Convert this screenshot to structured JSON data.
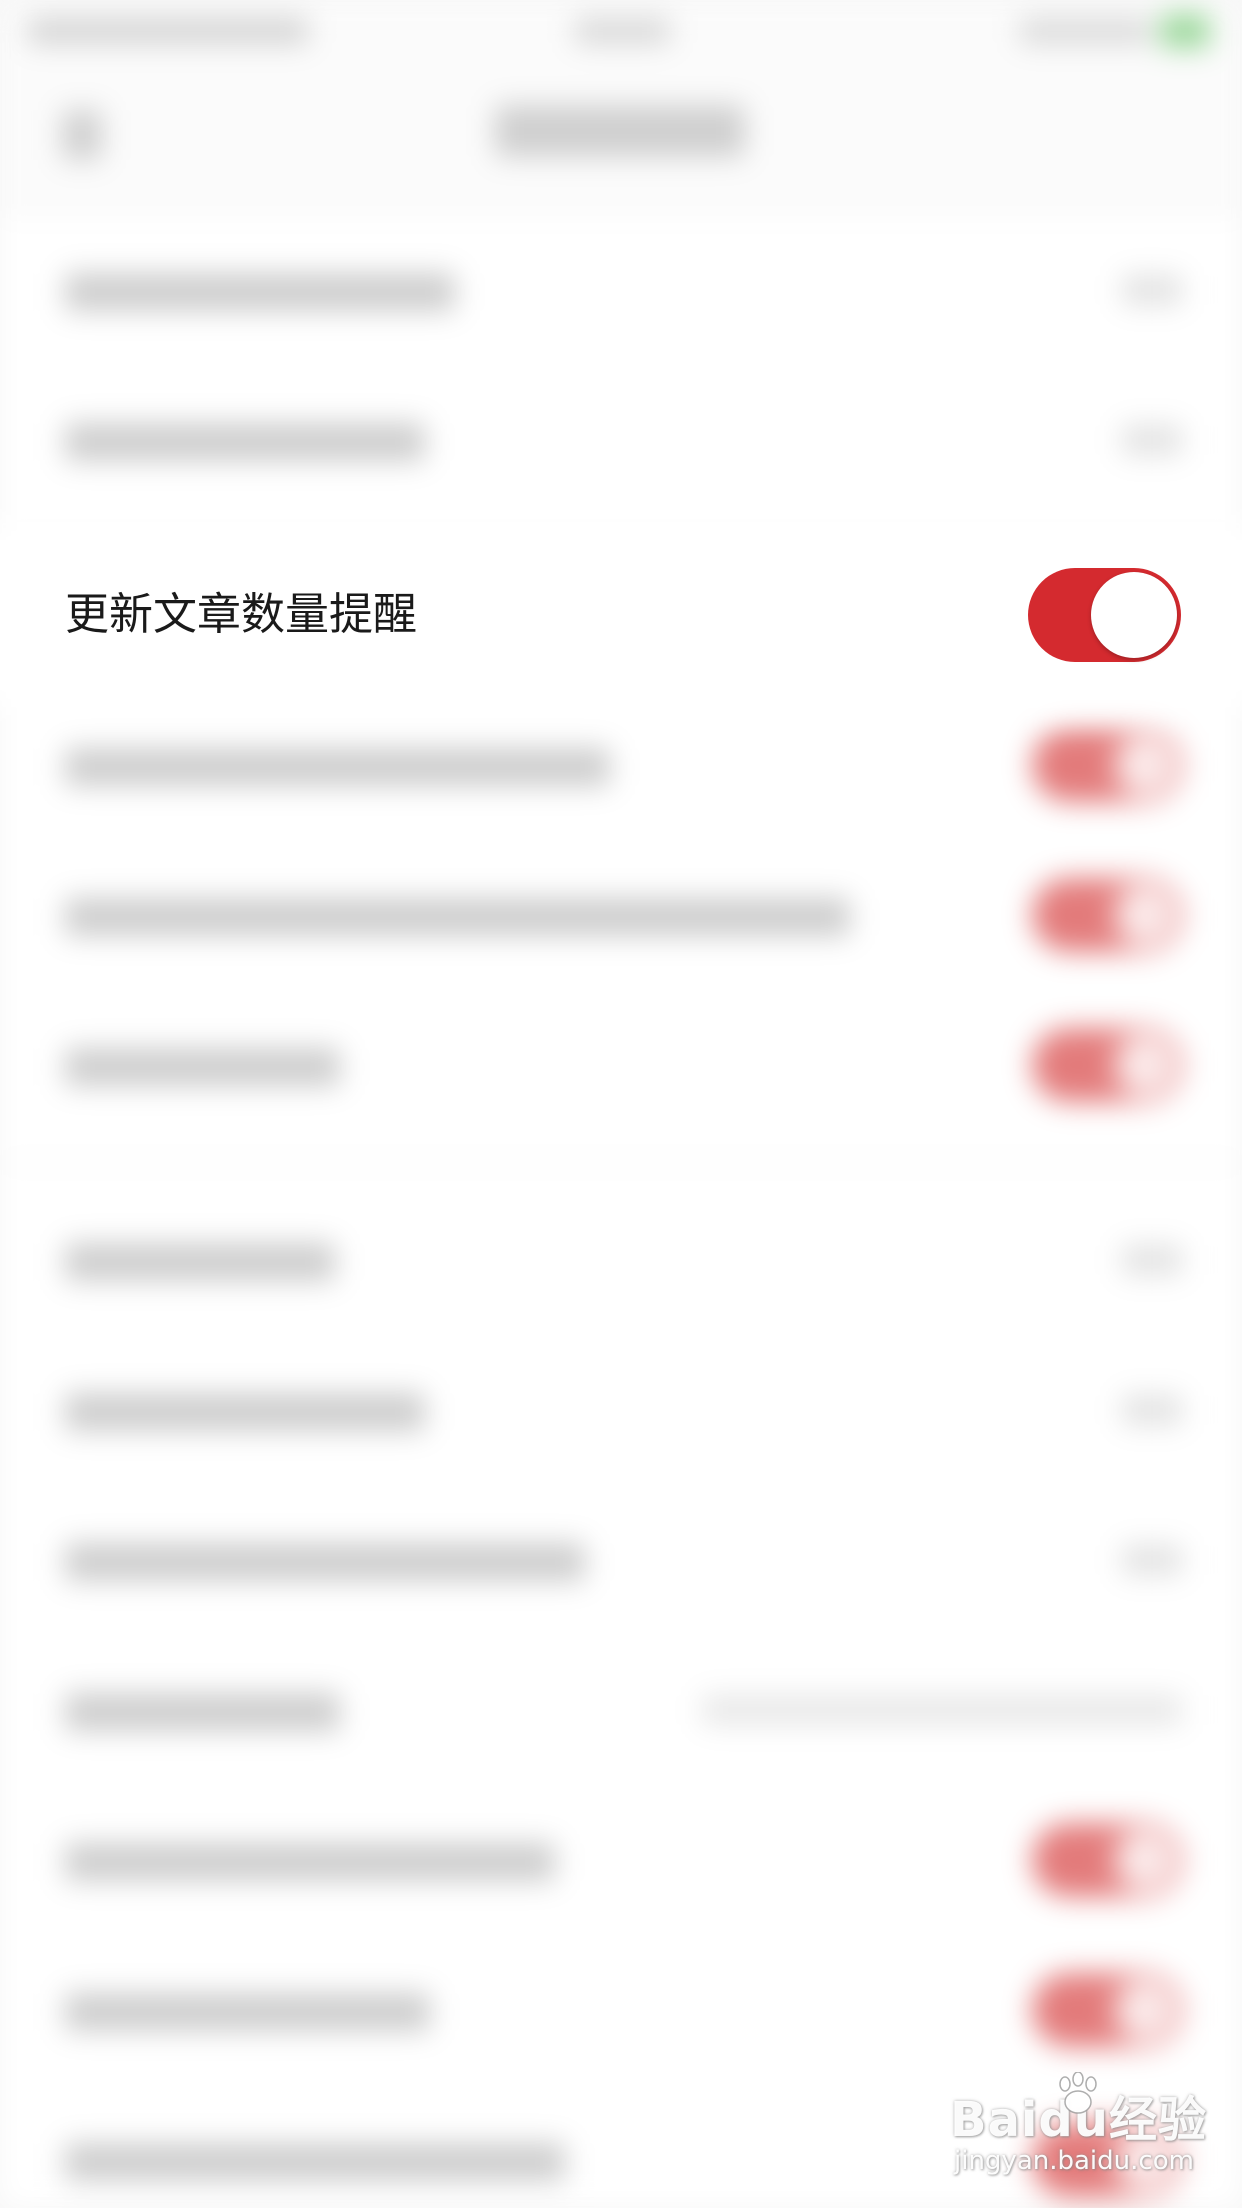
{
  "setting": {
    "label": "更新文章数量提醒",
    "enabled": true
  },
  "colors": {
    "toggle_on": "#d42a2f",
    "toggle_knob": "#ffffff",
    "background": "#f7f7f7"
  },
  "watermark": {
    "logo_text": "Baidu经验",
    "url": "jingyan.baidu.com"
  }
}
